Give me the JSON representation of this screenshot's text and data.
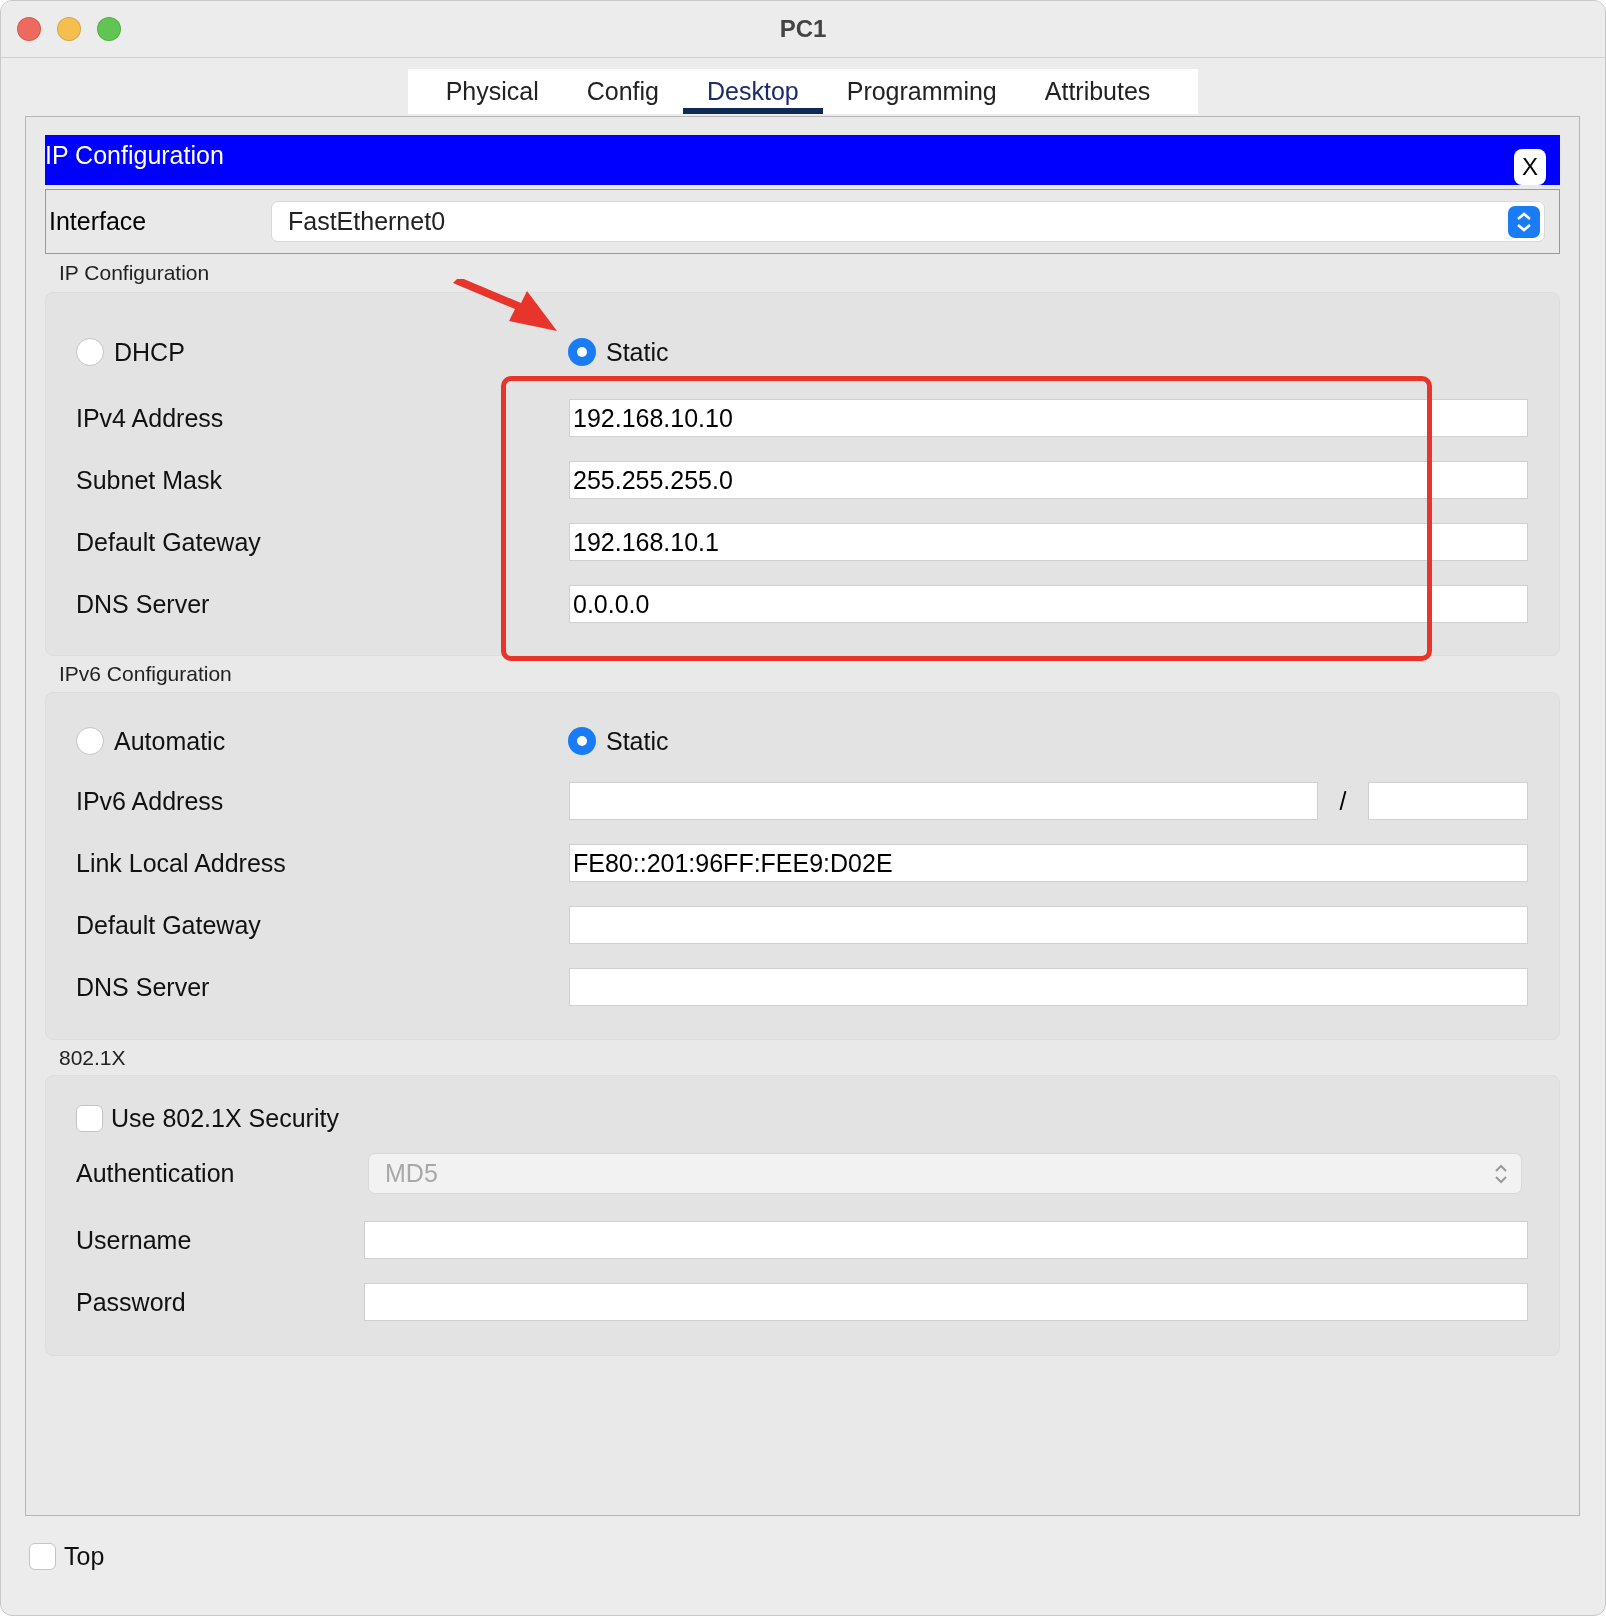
{
  "window": {
    "title": "PC1"
  },
  "tabs": [
    {
      "label": "Physical",
      "selected": false
    },
    {
      "label": "Config",
      "selected": false
    },
    {
      "label": "Desktop",
      "selected": true
    },
    {
      "label": "Programming",
      "selected": false
    },
    {
      "label": "Attributes",
      "selected": false
    }
  ],
  "dialog": {
    "title": "IP Configuration",
    "close": "X"
  },
  "interface": {
    "label": "Interface",
    "value": "FastEthernet0"
  },
  "ipv4": {
    "title": "IP Configuration",
    "modes": [
      {
        "label": "DHCP",
        "selected": false
      },
      {
        "label": "Static",
        "selected": true
      }
    ],
    "fields": [
      {
        "label": "IPv4 Address",
        "value": "192.168.10.10"
      },
      {
        "label": "Subnet Mask",
        "value": "255.255.255.0"
      },
      {
        "label": "Default Gateway",
        "value": "192.168.10.1"
      },
      {
        "label": "DNS Server",
        "value": "0.0.0.0"
      }
    ]
  },
  "ipv6": {
    "title": "IPv6 Configuration",
    "modes": [
      {
        "label": "Automatic",
        "selected": false
      },
      {
        "label": "Static",
        "selected": true
      }
    ],
    "fields": [
      {
        "label": "IPv6 Address",
        "kind": "prefixed",
        "separator": "/"
      },
      {
        "label": "Link Local Address",
        "kind": "text",
        "value": "FE80::201:96FF:FEE9:D02E"
      },
      {
        "label": "Default Gateway",
        "kind": "text"
      },
      {
        "label": "DNS Server",
        "kind": "text"
      }
    ]
  },
  "dot1x": {
    "title": "802.1X",
    "security": {
      "label": "Use 802.1X Security",
      "checked": false
    },
    "authentication": {
      "label": "Authentication",
      "value": "MD5",
      "disabled": true
    },
    "fields": [
      {
        "label": "Username"
      },
      {
        "label": "Password"
      }
    ]
  },
  "top": {
    "label": "Top",
    "checked": false
  }
}
